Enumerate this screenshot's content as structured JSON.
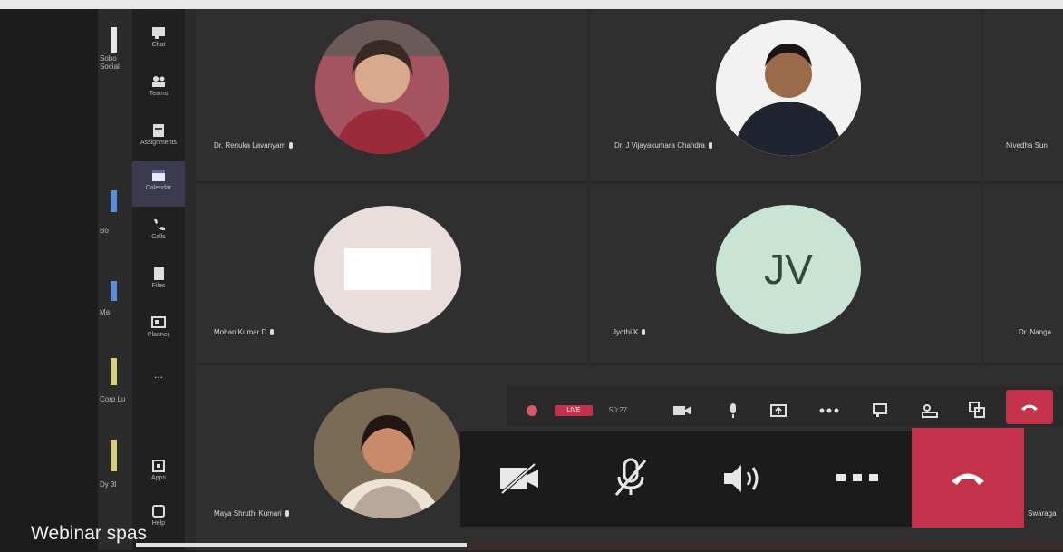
{
  "sidebar": {
    "items": [
      {
        "label": "Chat",
        "icon": "chat-icon",
        "active": false
      },
      {
        "label": "Teams",
        "icon": "teams-icon",
        "active": false
      },
      {
        "label": "Assignments",
        "icon": "assignments-icon",
        "active": false
      },
      {
        "label": "Calendar",
        "icon": "calendar-icon",
        "active": true
      },
      {
        "label": "Calls",
        "icon": "phone-icon",
        "active": false
      },
      {
        "label": "Files",
        "icon": "files-icon",
        "active": false
      },
      {
        "label": "Planner",
        "icon": "planner-icon",
        "active": false
      },
      {
        "label": "...",
        "icon": "more-icon",
        "active": false
      },
      {
        "label": "Apps",
        "icon": "apps-icon",
        "active": false
      },
      {
        "label": "Help",
        "icon": "help-icon",
        "active": false
      }
    ]
  },
  "outer_list": [
    {
      "label": "Sobo Social"
    },
    {
      "label": "Bo"
    },
    {
      "label": "Ma"
    },
    {
      "label": "Corp Lu"
    },
    {
      "label": "Dy 3I"
    }
  ],
  "participants": [
    {
      "name": "Dr. Renuka Lavanyam",
      "kind": "photo"
    },
    {
      "name": "Dr. J Vijayakumara Chandra",
      "kind": "photo"
    },
    {
      "name": "Nivedha Sun",
      "kind": "cut"
    },
    {
      "name": "Mohan Kumar D",
      "kind": "blank"
    },
    {
      "name": "Jyothi K",
      "initials": "JV",
      "kind": "initials"
    },
    {
      "name": "Dr. Nanga",
      "kind": "cut"
    },
    {
      "name": "Maya Shruthi Kumari",
      "kind": "photo"
    },
    {
      "name": "Swaraga",
      "kind": "cut"
    }
  ],
  "meeting_bar": {
    "live_label": "LIVE",
    "timer": "50:27"
  },
  "caption": "Webinar spas",
  "colors": {
    "hangup": "#c4314b",
    "accent": "#6264a7",
    "live": "#c4314b"
  }
}
